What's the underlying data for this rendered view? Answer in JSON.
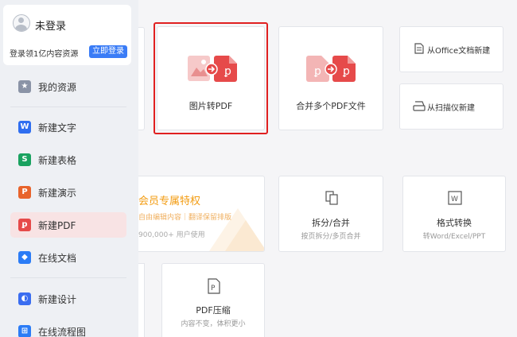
{
  "user": {
    "name": "未登录",
    "promo": "登录领1亿内容资源",
    "login_button": "立即登录"
  },
  "sidebar": {
    "items": [
      {
        "label": "我的资源",
        "icon": "star-icon",
        "color": "#8a93a6"
      },
      {
        "label": "新建文字",
        "icon": "writer-icon",
        "color": "#2f6ef0"
      },
      {
        "label": "新建表格",
        "icon": "spreadsheet-icon",
        "color": "#1aa260"
      },
      {
        "label": "新建演示",
        "icon": "presentation-icon",
        "color": "#e8632b"
      },
      {
        "label": "新建PDF",
        "icon": "pdf-icon",
        "color": "#e64a4a"
      },
      {
        "label": "在线文档",
        "icon": "cloud-doc-icon",
        "color": "#2b7cf6"
      },
      {
        "label": "新建设计",
        "icon": "design-icon",
        "color": "#3a6df0"
      },
      {
        "label": "在线流程图",
        "icon": "flowchart-icon",
        "color": "#2b7cf6"
      }
    ],
    "active_index": 4
  },
  "tools": {
    "image_to_pdf": "图片转PDF",
    "merge_pdf": "合并多个PDF文件",
    "from_office": "从Office文档新建",
    "from_scanner": "从扫描仪新建",
    "split_merge": {
      "title": "拆分/合并",
      "sub": "按页拆分/多页合并"
    },
    "format_convert": {
      "title": "格式转换",
      "sub": "转Word/Excel/PPT"
    },
    "compress": {
      "title": "PDF压缩",
      "sub": "内容不变，体积更小"
    }
  },
  "member": {
    "title": "会员专属特权",
    "sub": "自由编辑内容｜翻译保留排版",
    "users": "900,000+ 用户使用"
  },
  "colors": {
    "accent": "#3a7cf6",
    "pdf_red": "#e64a4a",
    "pdf_pink": "#f3b5b5",
    "highlight": "#e02020",
    "member_orange": "#f39c12"
  }
}
